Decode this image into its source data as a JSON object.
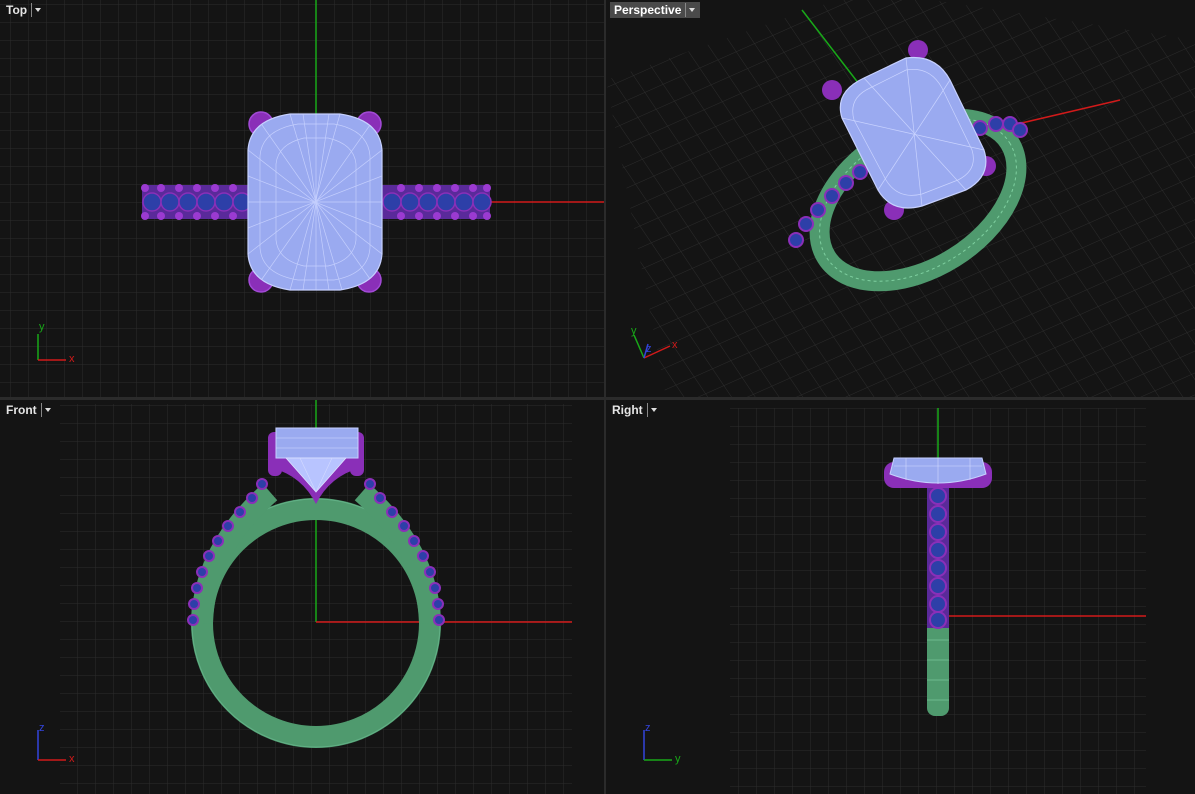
{
  "viewports": {
    "top": {
      "title": "Top",
      "axis_a": "y",
      "axis_b": "x"
    },
    "perspective": {
      "title": "Perspective",
      "axis_a": "y",
      "axis_b": "x",
      "axis_c": "z"
    },
    "front": {
      "title": "Front",
      "axis_a": "z",
      "axis_b": "x"
    },
    "right": {
      "title": "Right",
      "axis_a": "z",
      "axis_b": "y"
    }
  },
  "colors": {
    "background": "#141414",
    "grid": "#2c2c2c",
    "x_axis": "#d11a1a",
    "y_axis": "#18a818",
    "stone": "#9aaaf0",
    "metal_prongs": "#8a2fb8",
    "band": "#4f9a6e",
    "accent_stones": "#2d3fa8"
  },
  "icons": {
    "viewport_menu": "chevron-down-icon",
    "axis_widget": "axis-triad-icon"
  }
}
